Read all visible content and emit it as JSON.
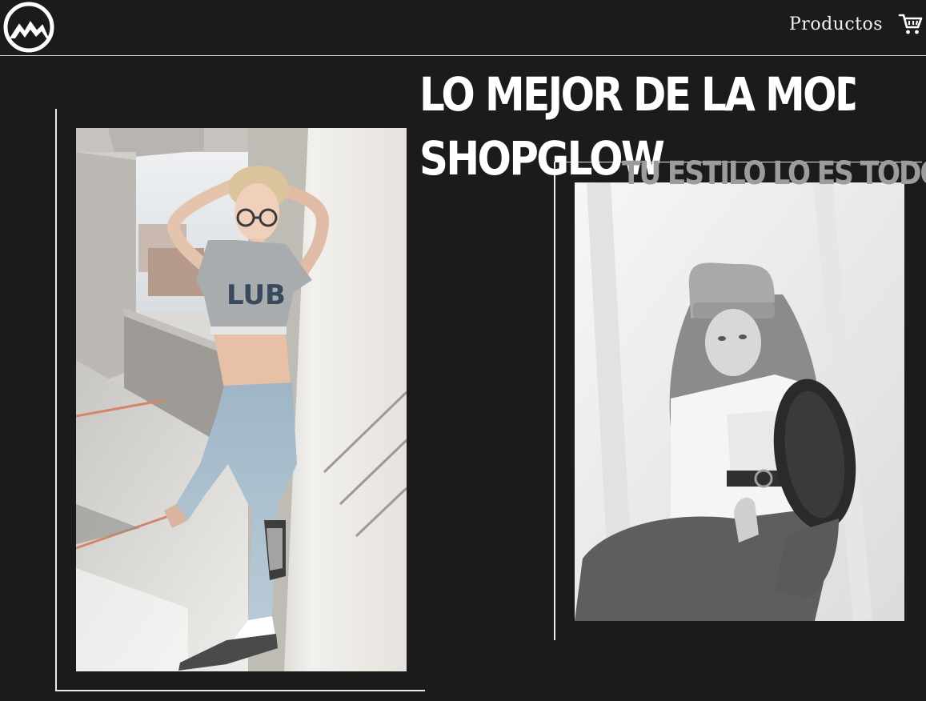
{
  "header": {
    "nav_products": "Productos"
  },
  "hero": {
    "headline_line1": "LO MEJOR DE LA MODA SOLO EN",
    "headline_line2": "SHOPGLOW",
    "tagline": "TU ESTILO LO ES TODO"
  },
  "icons": {
    "logo": "mountain-logo-icon",
    "cart": "shopping-cart-icon"
  },
  "colors": {
    "background": "#1c1b1b",
    "text": "#ffffff",
    "tagline": "#9c9c9c"
  }
}
